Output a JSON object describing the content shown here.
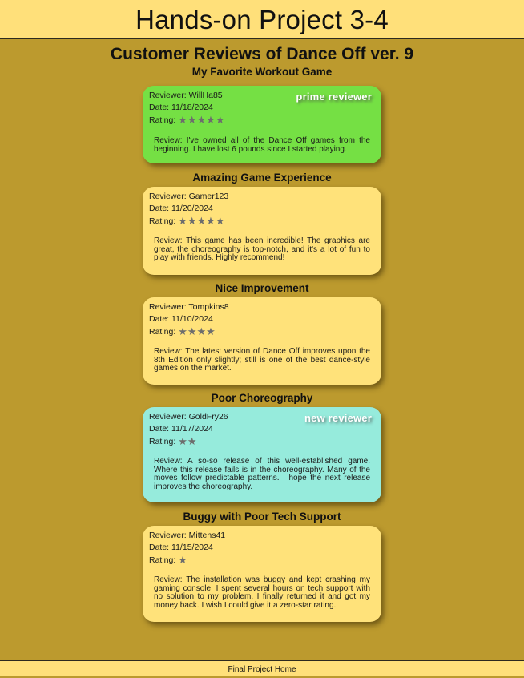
{
  "header": {
    "title": "Hands-on Project 3-4"
  },
  "main": {
    "heading": "Customer Reviews of Dance Off ver. 9"
  },
  "labels": {
    "reviewer": "Reviewer:",
    "date": "Date:",
    "rating": "Rating:",
    "review": "Review:"
  },
  "reviews": [
    {
      "title": "My Favorite Workout Game",
      "reviewer": "WillHa85",
      "date": "11/18/2024",
      "stars": "★★★★★",
      "rating": 5,
      "badge": "prime reviewer",
      "text": "I've owned all of the Dance Off games from the beginning. I have lost 6 pounds since I started playing.",
      "color": "#75e044"
    },
    {
      "title": "Amazing Game Experience",
      "reviewer": "Gamer123",
      "date": "11/20/2024",
      "stars": "★★★★★",
      "rating": 5,
      "text": "This game has been incredible! The graphics are great, the choreography is top-notch, and it's a lot of fun to play with friends. Highly recommend!",
      "color": "#ffe27a"
    },
    {
      "title": "Nice Improvement",
      "reviewer": "Tompkins8",
      "date": "11/10/2024",
      "stars": "★★★★",
      "rating": 4,
      "text": "The latest version of Dance Off improves upon the 8th Edition only slightly; still is one of the best dance-style games on the market.",
      "color": "#ffe27a"
    },
    {
      "title": "Poor Choreography",
      "reviewer": "GoldFry26",
      "date": "11/17/2024",
      "stars": "★★",
      "rating": 2,
      "badge": "new reviewer",
      "text": "A so-so release of this well-established game. Where this release fails is in the choreography. Many of the moves follow predictable patterns. I hope the next release improves the choreography.",
      "color": "#96ebdc"
    },
    {
      "title": "Buggy with Poor Tech Support",
      "reviewer": "Mittens41",
      "date": "11/15/2024",
      "stars": "★",
      "rating": 1,
      "text": "The installation was buggy and kept crashing my gaming console. I spent several hours on tech support with no solution to my problem. I finally returned it and got my money back. I wish I could give it a zero-star rating.",
      "color": "#ffe27a"
    }
  ],
  "footer": {
    "link": "Final Project Home"
  },
  "colors": {
    "page_background": "#bc9a2e",
    "header_background": "#ffe07a",
    "star_color": "#6d6d6d"
  }
}
